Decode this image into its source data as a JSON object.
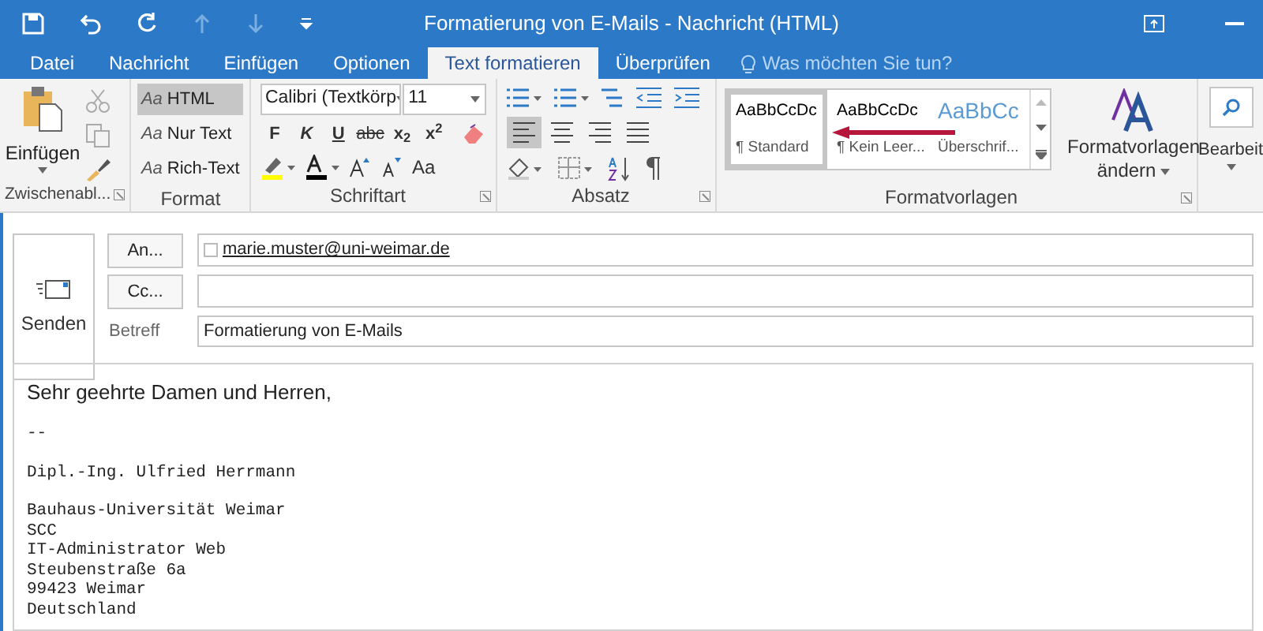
{
  "window": {
    "title": "Formatierung von E-Mails - Nachricht (HTML)"
  },
  "tabs": [
    {
      "label": "Datei",
      "selected": false
    },
    {
      "label": "Nachricht",
      "selected": false
    },
    {
      "label": "Einfügen",
      "selected": false
    },
    {
      "label": "Optionen",
      "selected": false
    },
    {
      "label": "Text formatieren",
      "selected": true
    },
    {
      "label": "Überprüfen",
      "selected": false
    }
  ],
  "tell_me": {
    "placeholder": "Was möchten Sie tun?"
  },
  "ribbon": {
    "clipboard": {
      "label": "Zwischenabl...",
      "paste": "Einfügen"
    },
    "format": {
      "label": "Format",
      "options": [
        {
          "prefix": "Aa",
          "label": "HTML",
          "selected": true
        },
        {
          "prefix": "Aa",
          "label": "Nur Text",
          "selected": false
        },
        {
          "prefix": "Aa",
          "label": "Rich-Text",
          "selected": false
        }
      ]
    },
    "font": {
      "label": "Schriftart",
      "family": "Calibri (Textkörp",
      "size": "11",
      "buttons": [
        "F",
        "K",
        "U",
        "abc",
        "x$_{2}$",
        "x$^{2}$"
      ],
      "case": "Aa"
    },
    "paragraph": {
      "label": "Absatz",
      "alignments": [
        {
          "selected": true
        },
        {
          "selected": false
        },
        {
          "selected": false
        },
        {
          "selected": false
        }
      ]
    },
    "styles": {
      "label": "Formatvorlagen",
      "items": [
        {
          "kind": "normal",
          "preview": "AaBbCcDc",
          "name": "¶ Standard",
          "selected": true
        },
        {
          "kind": "normal",
          "preview": "AaBbCcDc",
          "name": "¶ Kein Leer...",
          "selected": false
        },
        {
          "kind": "heading",
          "preview": "AaBbCc",
          "name": "Überschrif...",
          "selected": false
        }
      ],
      "change": [
        "Formatvorlagen",
        "ändern"
      ]
    },
    "editing": {
      "label": "Bearbeit"
    }
  },
  "compose": {
    "send": "Senden",
    "to_button": "An...",
    "cc_button": "Cc...",
    "to": "marie.muster@uni-weimar.de",
    "to_checked": false,
    "subject_label": "Betreff",
    "subject": "Formatierung von E-Mails"
  },
  "body": [
    {
      "kind": "greeting",
      "lines": [
        "Sehr geehrte Damen und Herren,"
      ]
    },
    {
      "kind": "signature",
      "lines": [
        "--"
      ]
    },
    {
      "kind": "signature",
      "lines": [
        "Dipl.-Ing. Ulfried Herrmann"
      ]
    },
    {
      "kind": "signature",
      "lines": [
        "Bauhaus-Universität Weimar",
        "SCC",
        "IT-Administrator Web",
        "Steubenstraße 6a",
        "99423 Weimar",
        "Deutschland"
      ]
    }
  ]
}
